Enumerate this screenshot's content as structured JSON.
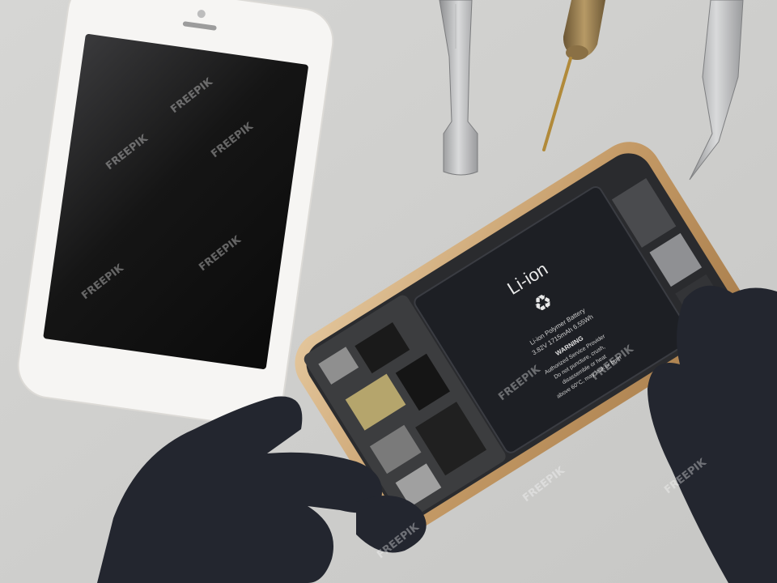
{
  "scene": {
    "background": "#cfcfcf",
    "objects": [
      "white-smartphone",
      "pry-tool",
      "screwdriver",
      "tweezers",
      "open-phone",
      "battery",
      "gloved-hands"
    ]
  },
  "battery": {
    "brand_label": "Li-ion",
    "lines": [
      "Li-ion Polymer Battery",
      "3.82V 1715mAh 6.55Wh",
      "WARNING",
      "Authorized Service Provider",
      "Do not puncture, crush,",
      "disassemble or heat",
      "above 60°C, may leak or burn"
    ]
  },
  "watermark": {
    "text": "FREEPIK"
  },
  "colors": {
    "phone_white": "#f6f5f3",
    "screen_dark": "#111111",
    "gold_frame": "#c9a67a",
    "battery_black": "#1d1f24",
    "glove": "#23262f"
  }
}
